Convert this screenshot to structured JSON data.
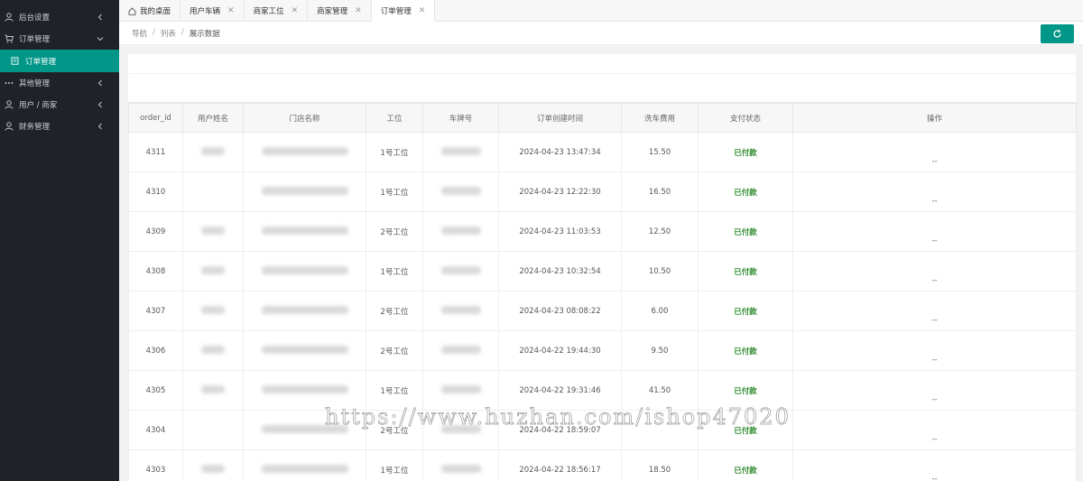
{
  "sidebar": {
    "items": [
      {
        "label": "后台设置",
        "expanded": false
      },
      {
        "label": "订单管理",
        "expanded": true
      },
      {
        "label": "订单管理",
        "active": true
      },
      {
        "label": "其他管理",
        "expanded": false
      },
      {
        "label": "用户 / 商家",
        "expanded": false
      },
      {
        "label": "财务管理",
        "expanded": false
      }
    ]
  },
  "tabs": [
    {
      "label": "我的桌面",
      "closable": false,
      "icon": "home-icon"
    },
    {
      "label": "用户车辆",
      "closable": true
    },
    {
      "label": "商家工位",
      "closable": true
    },
    {
      "label": "商家管理",
      "closable": true
    },
    {
      "label": "订单管理",
      "closable": true,
      "active": true
    }
  ],
  "breadcrumb": [
    "导航",
    "列表",
    "展示数据"
  ],
  "refresh_icon": "refresh-icon",
  "colors": {
    "sidebar_bg": "#20222a",
    "accent": "#009688",
    "paid": "#2e8b2e"
  },
  "table": {
    "columns": [
      "order_id",
      "用户姓名",
      "门店名称",
      "工位",
      "车牌号",
      "订单创建时间",
      "洗车费用",
      "支付状态",
      "操作"
    ],
    "rows": [
      {
        "order_id": "4311",
        "user": "[blurred]",
        "store": "[blurred]",
        "bay": "1号工位",
        "plate": "[blurred]",
        "created": "2024-04-23 13:47:34",
        "fee": "15.50",
        "status": "已付款",
        "op": "--"
      },
      {
        "order_id": "4310",
        "user": "",
        "store": "[blurred]",
        "bay": "1号工位",
        "plate": "[blurred]",
        "created": "2024-04-23 12:22:30",
        "fee": "16.50",
        "status": "已付款",
        "op": "--"
      },
      {
        "order_id": "4309",
        "user": "[blurred]",
        "store": "[blurred]",
        "bay": "2号工位",
        "plate": "[blurred]",
        "created": "2024-04-23 11:03:53",
        "fee": "12.50",
        "status": "已付款",
        "op": "--"
      },
      {
        "order_id": "4308",
        "user": "[blurred]",
        "store": "[blurred]",
        "bay": "1号工位",
        "plate": "[blurred]",
        "created": "2024-04-23 10:32:54",
        "fee": "10.50",
        "status": "已付款",
        "op": "--"
      },
      {
        "order_id": "4307",
        "user": "[blurred]",
        "store": "[blurred]",
        "bay": "2号工位",
        "plate": "[blurred]",
        "created": "2024-04-23 08:08:22",
        "fee": "6.00",
        "status": "已付款",
        "op": "--"
      },
      {
        "order_id": "4306",
        "user": "[blurred]",
        "store": "[blurred]",
        "bay": "2号工位",
        "plate": "[blurred]",
        "created": "2024-04-22 19:44:30",
        "fee": "9.50",
        "status": "已付款",
        "op": "--"
      },
      {
        "order_id": "4305",
        "user": "[blurred]",
        "store": "[blurred]",
        "bay": "1号工位",
        "plate": "[blurred]",
        "created": "2024-04-22 19:31:46",
        "fee": "41.50",
        "status": "已付款",
        "op": "--"
      },
      {
        "order_id": "4304",
        "user": "",
        "store": "[blurred]",
        "bay": "2号工位",
        "plate": "[blurred]",
        "created": "2024-04-22 18:59:07",
        "fee": "",
        "status": "已付款",
        "op": "--"
      },
      {
        "order_id": "4303",
        "user": "[blurred]",
        "store": "[blurred]",
        "bay": "1号工位",
        "plate": "[blurred]",
        "created": "2024-04-22 18:56:17",
        "fee": "18.50",
        "status": "已付款",
        "op": "--"
      }
    ]
  },
  "watermark": "https://www.huzhan.com/ishop47020"
}
